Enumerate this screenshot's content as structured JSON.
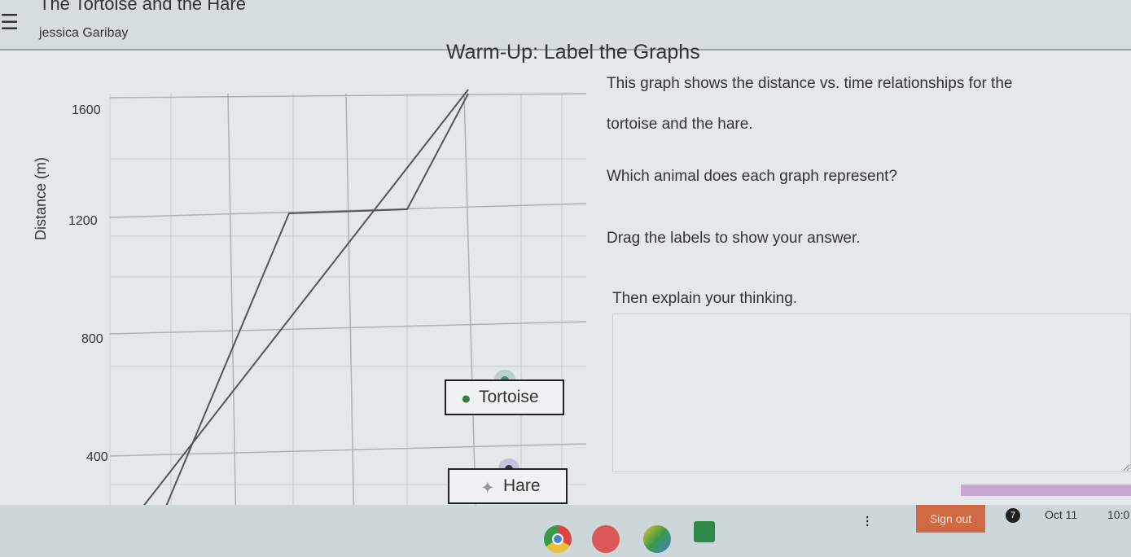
{
  "header": {
    "title": "The Tortoise and the Hare",
    "user": "jessica Garibay",
    "menu_icon": "hamburger-icon"
  },
  "activity": {
    "heading": "Warm-Up: Label the Graphs",
    "paragraphs": [
      "This graph shows the distance vs. time relationships for the",
      "tortoise and the hare.",
      "Which animal does each graph represent?",
      "Drag the labels to show your answer.",
      "Then explain your thinking."
    ]
  },
  "graph": {
    "y_title": "Distance (m)",
    "y_ticks": [
      "1600",
      "1200",
      "800",
      "400"
    ]
  },
  "labels": {
    "tortoise": "Tortoise",
    "hare": "Hare"
  },
  "taskbar": {
    "sign_out": "Sign out",
    "notifications": "7",
    "date": "Oct 11",
    "time": "10:0",
    "apps": [
      "chrome-icon",
      "paint-icon",
      "drive-icon",
      "classroom-icon"
    ]
  },
  "colors": {
    "sign_out": "#cf6a45",
    "tortoise_dot": "#4a8a6a",
    "hare_dot": "#333344"
  }
}
